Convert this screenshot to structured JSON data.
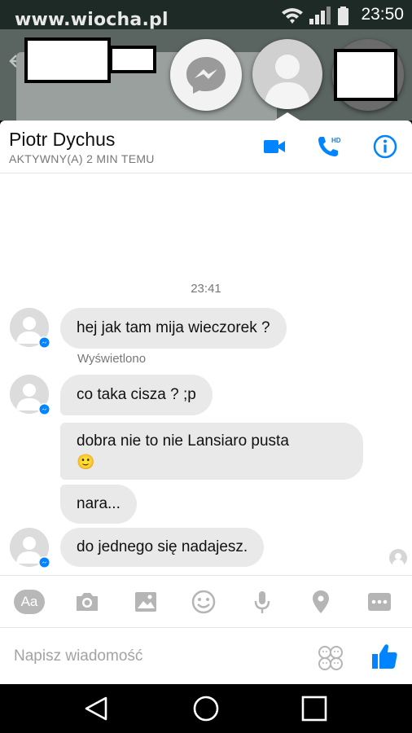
{
  "watermark": "www.wiocha.pl",
  "status_bar": {
    "time": "23:50"
  },
  "colors": {
    "accent": "#0084ff",
    "bubble": "#e9e9e9",
    "status_bar": "#1e2a26"
  },
  "chat": {
    "contact_name": "Piotr Dychus",
    "contact_status": "AKTYWNY(A) 2 MIN TEMU",
    "header_icons": [
      "video-call-icon",
      "hd-phone-icon",
      "info-icon"
    ],
    "timestamp": "23:41",
    "seen_label": "Wyświetlono",
    "messages": [
      {
        "text": "hej jak tam mija wieczorek ?"
      },
      {
        "text": "co taka cisza ? ;p"
      },
      {
        "text": "dobra nie to nie Lansiaro pusta",
        "emoji": "🙂"
      },
      {
        "text": "nara..."
      },
      {
        "text": "do jednego się nadajesz."
      }
    ]
  },
  "toolbar": {
    "aa_label": "Aa",
    "icons": [
      "text-format-icon",
      "camera-icon",
      "gallery-icon",
      "emoji-icon",
      "microphone-icon",
      "location-icon",
      "more-icon"
    ]
  },
  "compose": {
    "placeholder": "Napisz wiadomość"
  }
}
